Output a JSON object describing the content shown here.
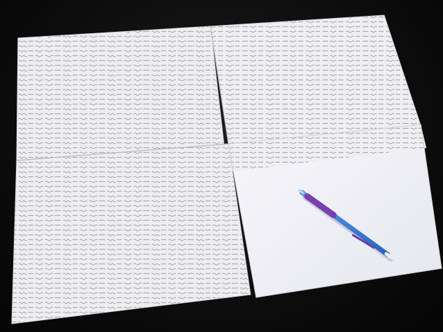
{
  "scene": {
    "subject": "",
    "colors": {
      "tabletop": "#0d0d0d",
      "paper": "#f2f2f4",
      "paper_shadow": "#c9c9cf",
      "ink": "#5a5a66",
      "pencil_body": "#3a7ed6",
      "pencil_grip": "#7a3fb0",
      "pencil_tip": "#c9d6e6"
    }
  }
}
